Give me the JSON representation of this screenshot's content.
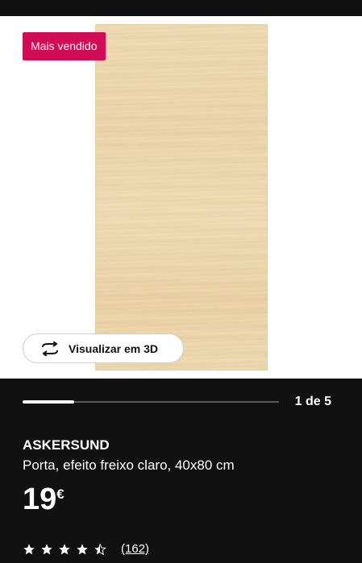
{
  "badge": {
    "label": "Mais vendido",
    "color": "#d10c54"
  },
  "viewer": {
    "label": "Visualizar em 3D",
    "icon": "rotate-3d-icon"
  },
  "gallery": {
    "pager_text": "1 de 5",
    "current": 1,
    "total": 5
  },
  "product": {
    "name": "ASKERSUND",
    "description": "Porta, efeito freixo claro, 40x80 cm",
    "price": "19",
    "currency": "€"
  },
  "rating": {
    "value": 4.5,
    "max": 5,
    "review_count_text": "(162)"
  }
}
